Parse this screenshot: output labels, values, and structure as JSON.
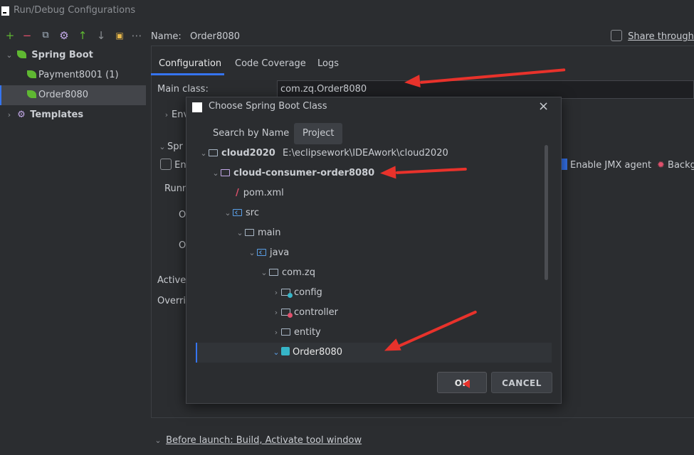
{
  "window": {
    "title": "Run/Debug Configurations"
  },
  "toolbar": {
    "add": "+",
    "remove": "−",
    "copy": "⧉",
    "settings": "⚙",
    "up": "↑",
    "down": "↓",
    "folder": "▣",
    "more": "⋯"
  },
  "left_tree": {
    "spring_boot": "Spring Boot",
    "payment": "Payment8001 (1)",
    "order": "Order8080",
    "templates": "Templates"
  },
  "config": {
    "name_label": "Name:",
    "name_value": "Order8080",
    "share_label": "Share through V",
    "tabs": [
      "Configuration",
      "Code Coverage",
      "Logs"
    ],
    "main_class_label": "Main class:",
    "main_class_value": "com.zq.Order8080",
    "env_label": "Env",
    "spr_label": "Spr",
    "en_label": "En",
    "runn_label": "Runn",
    "o1": "O",
    "o2": "O",
    "active_label": "Active",
    "overri_label": "Overric",
    "jmx_label": "Enable JMX agent",
    "backg_label": "Backg",
    "before_launch": "Before launch: Build, Activate tool window"
  },
  "dialog": {
    "title": "Choose Spring Boot Class",
    "close": "×",
    "tabs": [
      "Search by Name",
      "Project"
    ],
    "tree": {
      "root": "cloud2020",
      "root_path": "E:\\eclipsework\\IDEAwork\\cloud2020",
      "module": "cloud-consumer-order8080",
      "pom": "pom.xml",
      "src": "src",
      "main": "main",
      "java": "java",
      "pkg": "com.zq",
      "config": "config",
      "controller": "controller",
      "entity": "entity",
      "cls": "Order8080"
    },
    "ok": "OK",
    "cancel": "CANCEL"
  },
  "colors": {
    "accent": "#3574f0",
    "annotation": "#e8322b",
    "spring": "#5fb832"
  }
}
